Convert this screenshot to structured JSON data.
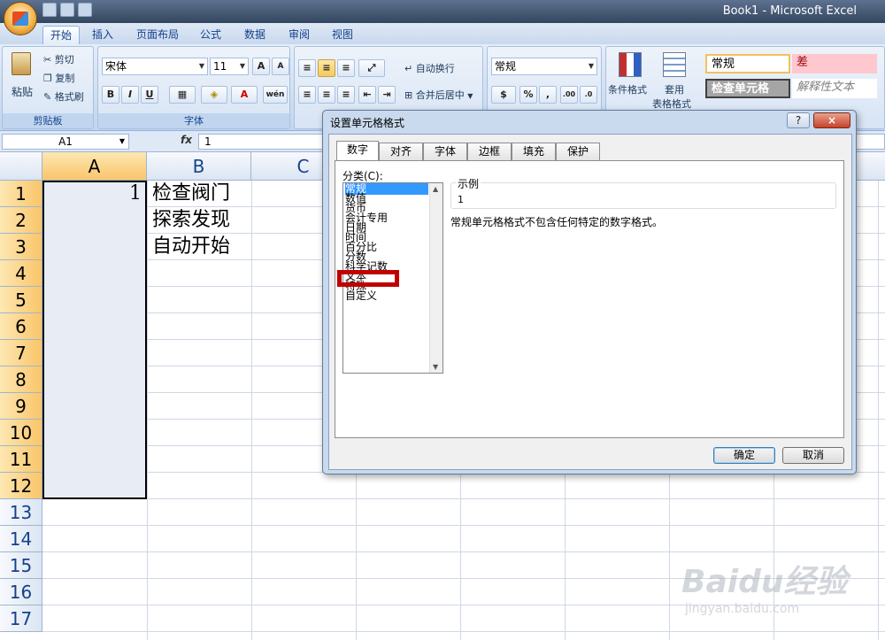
{
  "window": {
    "title": "Book1 - Microsoft Excel"
  },
  "tabs": [
    "开始",
    "插入",
    "页面布局",
    "公式",
    "数据",
    "审阅",
    "视图"
  ],
  "active_tab": "开始",
  "ribbon": {
    "clipboard": {
      "paste": "粘贴",
      "cut": "剪切",
      "copy": "复制",
      "format_painter": "格式刷",
      "label": "剪贴板"
    },
    "font": {
      "name": "宋体",
      "size": "11",
      "bold": "B",
      "italic": "I",
      "underline": "U",
      "grow": "A",
      "shrink": "A",
      "wen": "wén",
      "label": "字体"
    },
    "alignment": {
      "wrap": "自动换行",
      "merge": "合并后居中"
    },
    "number": {
      "format": "常规",
      "percent": "%",
      "comma": ",",
      "inc": ".00",
      "dec": ".0"
    },
    "styles": {
      "conditional": "条件格式",
      "table_1": "套用",
      "table_2": "表格格式",
      "normal": "常规",
      "bad": "差",
      "check": "检查单元格",
      "explanatory": "解释性文本",
      "label_partial": "样式"
    }
  },
  "formula_bar": {
    "name_box": "A1",
    "fx": "fx",
    "value": "1"
  },
  "columns": [
    "A",
    "B",
    "C"
  ],
  "rows": [
    "1",
    "2",
    "3",
    "4",
    "5",
    "6",
    "7",
    "8",
    "9",
    "10",
    "11",
    "12",
    "13",
    "14",
    "15",
    "16",
    "17"
  ],
  "cells": {
    "A1": "1",
    "B1": "检查阀门",
    "B2": "探索发现",
    "B3": "自动开始"
  },
  "dialog": {
    "title": "设置单元格格式",
    "help": "?",
    "close": "×",
    "tabs": [
      "数字",
      "对齐",
      "字体",
      "边框",
      "填充",
      "保护"
    ],
    "active_tab": "数字",
    "category_label": "分类(C):",
    "categories": [
      "常规",
      "数值",
      "货币",
      "会计专用",
      "日期",
      "时间",
      "百分比",
      "分数",
      "科学记数",
      "文本",
      "特殊",
      "自定义"
    ],
    "selected_category": "常规",
    "highlighted_category": "文本",
    "sample_label": "示例",
    "sample_value": "1",
    "description": "常规单元格格式不包含任何特定的数字格式。",
    "ok": "确定",
    "cancel": "取消"
  },
  "watermark": {
    "brand": "Baidu经验",
    "url": "jingyan.baidu.com"
  }
}
